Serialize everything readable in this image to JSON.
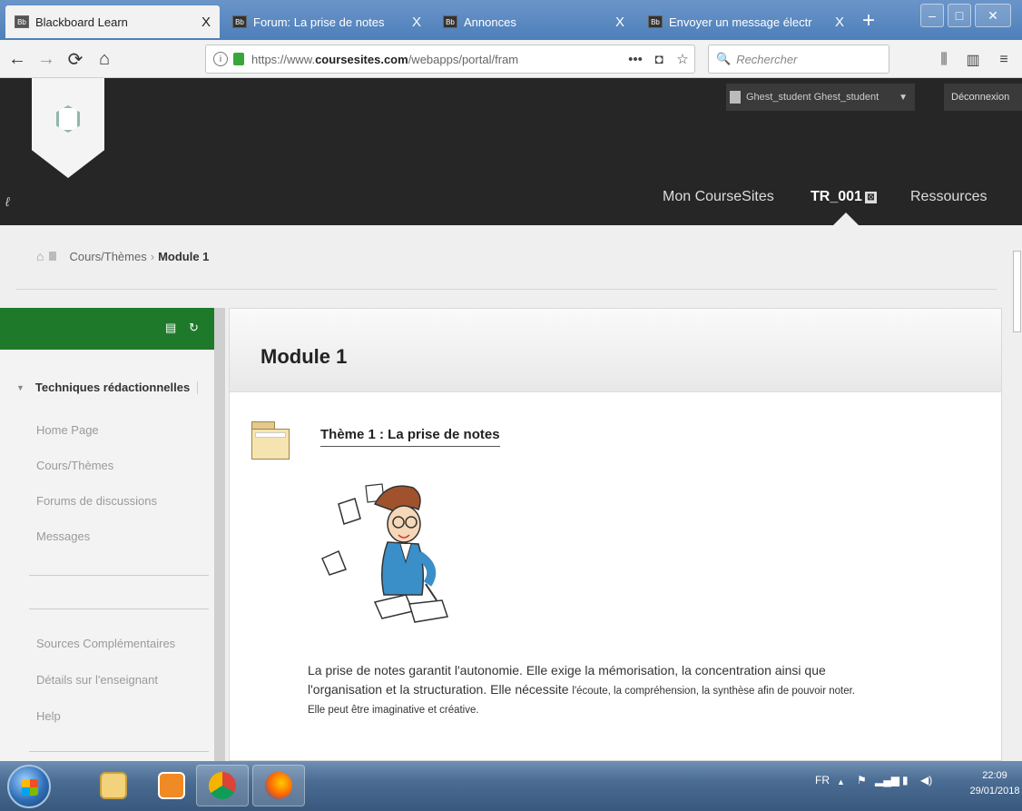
{
  "tabs": [
    {
      "label": "Blackboard Learn",
      "close": "X",
      "favicon": "Bb"
    },
    {
      "label": "Forum: La prise de notes",
      "close": "X",
      "favicon": "Bb"
    },
    {
      "label": "Annonces",
      "close": "X",
      "favicon": "Bb"
    },
    {
      "label": "Envoyer un message électr",
      "close": "X",
      "favicon": "Bb"
    }
  ],
  "window_controls": {
    "minimize": "–",
    "maximize": "□",
    "close": "✕"
  },
  "nav": {
    "back": "←",
    "forward": "→",
    "reload": "⟳",
    "home": "⌂",
    "url_prefix": "https://www.",
    "url_domain": "coursesites.com",
    "url_suffix": "/webapps/portal/fram",
    "more": "•••",
    "pocket": "◘",
    "bookmark": "☆",
    "search_icon": "🔍",
    "search_placeholder": "Rechercher",
    "library": "⫼",
    "sidebar": "▥",
    "menu": "≡"
  },
  "header": {
    "user_label": "Ghest_student Ghest_student",
    "dropdown": "▼",
    "logout_label": "Déconnexion",
    "edit_icon": "ℓ",
    "top_nav": [
      {
        "label": "Mon CourseSites"
      },
      {
        "label": "TR_001",
        "badge": "⊠"
      },
      {
        "label": "Ressources"
      }
    ]
  },
  "breadcrumb": {
    "home_icon": "⌂",
    "item1": "Cours/Thèmes",
    "separator": "›",
    "current": "Module 1"
  },
  "sidebar": {
    "head_icons": {
      "folder": "▤",
      "refresh": "↻"
    },
    "course_title": "Techniques rédactionnelles",
    "expand_icon": "▼",
    "items_top": [
      "Home Page",
      "Cours/Thèmes",
      "Forums de discussions",
      "Messages"
    ],
    "items_bottom": [
      "Sources Complémentaires",
      "Détails sur l'enseignant",
      "Help"
    ]
  },
  "content": {
    "page_title": "Module 1",
    "item_title": "Thème 1 : La prise de notes",
    "desc_line1": "La prise de notes garantit l'autonomie. Elle exige la mémorisation, la concentration ainsi que",
    "desc_line2a": "l'organisation et la structuration. Elle nécessite ",
    "desc_line2b": "l'écoute, la compréhension, la synthèse afin de pouvoir noter.",
    "desc_line3": "Elle peut être imaginative et créative."
  },
  "taskbar": {
    "lang": "FR",
    "tray_up": "▲",
    "time": "22:09",
    "date": "29/01/2018"
  },
  "colors": {
    "tab_bar": "#4e7fb9",
    "site_header": "#262626",
    "sidebar_head": "#1e7a2a",
    "page_bg": "#efefef"
  }
}
